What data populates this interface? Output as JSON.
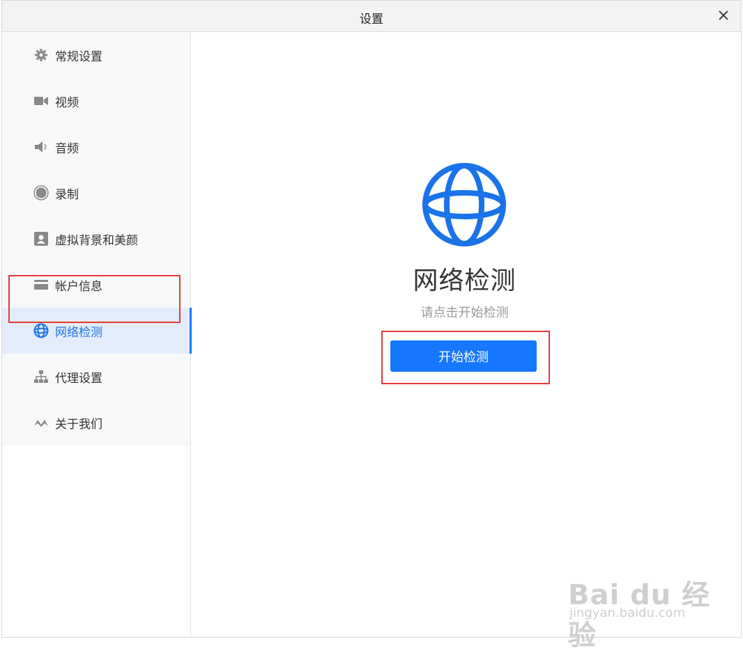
{
  "window": {
    "title": "设置"
  },
  "sidebar": {
    "items": [
      {
        "label": "常规设置",
        "icon": "gear-icon"
      },
      {
        "label": "视频",
        "icon": "video-camera-icon"
      },
      {
        "label": "音频",
        "icon": "speaker-icon"
      },
      {
        "label": "录制",
        "icon": "record-icon"
      },
      {
        "label": "虚拟背景和美颜",
        "icon": "portrait-icon"
      },
      {
        "label": "帐户信息",
        "icon": "card-icon"
      },
      {
        "label": "网络检测",
        "icon": "globe-icon"
      },
      {
        "label": "代理设置",
        "icon": "network-tree-icon"
      },
      {
        "label": "关于我们",
        "icon": "logo-icon"
      }
    ],
    "active_index": 6
  },
  "main": {
    "title": "网络检测",
    "hint": "请点击开始检测",
    "start_button": "开始检测"
  },
  "watermark": {
    "brand": "Bai du 经验",
    "url": "jingyan.baidu.com"
  },
  "colors": {
    "accent": "#1677ff",
    "globe": "#1a73e8",
    "highlight": "#e53935",
    "active_bg": "#e3ecfa",
    "sidebar_bg": "#f7f8fa"
  }
}
